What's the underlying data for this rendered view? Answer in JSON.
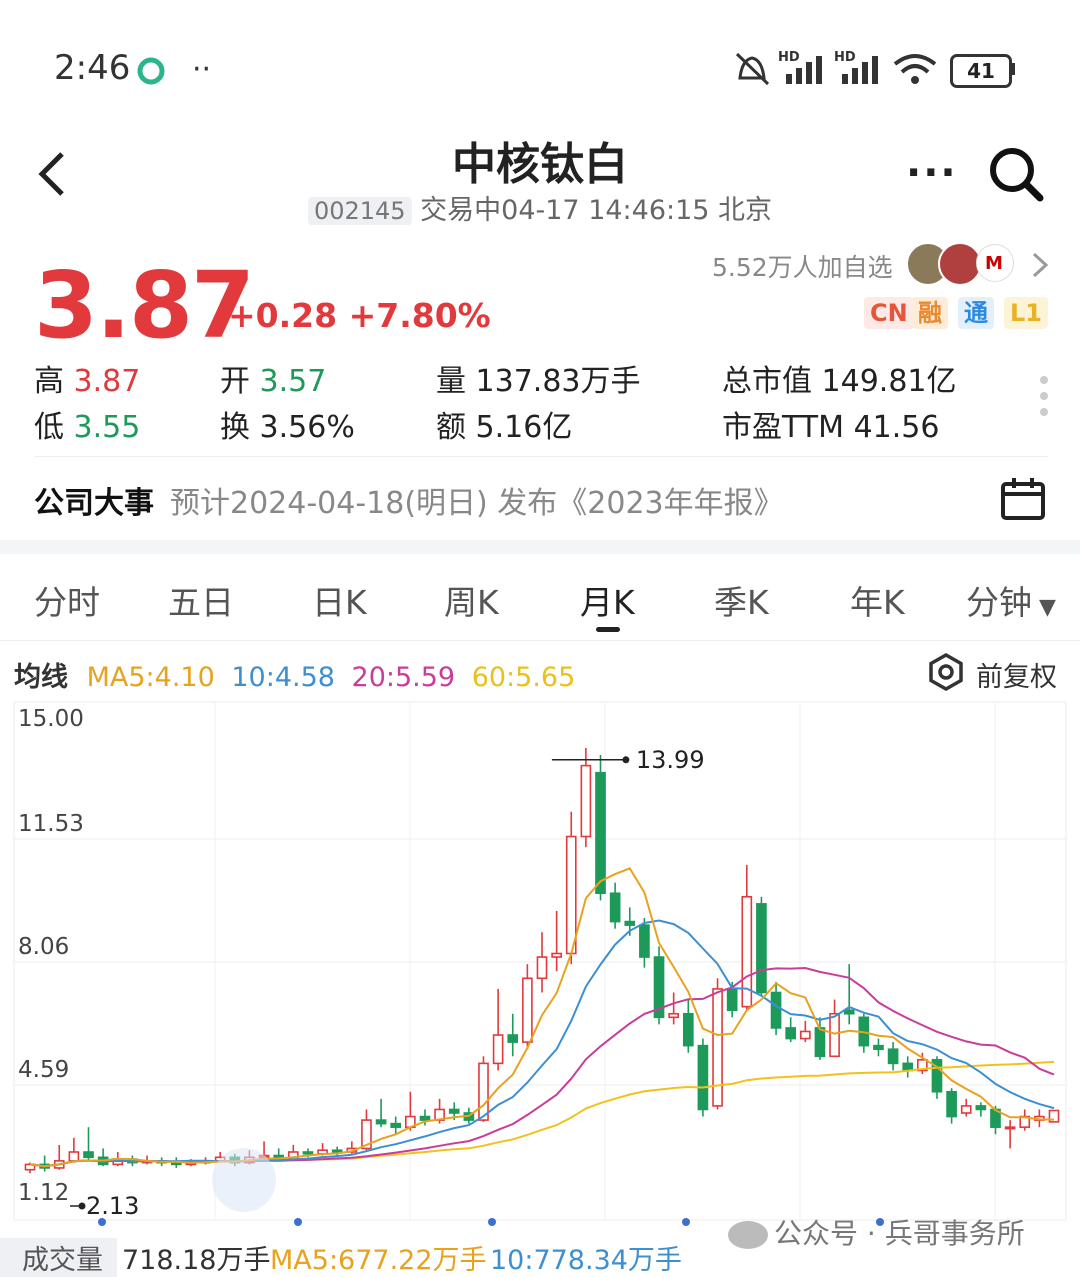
{
  "status": {
    "time": "2:46",
    "battery": "41",
    "signal1": "HD",
    "signal2": "HD"
  },
  "header": {
    "title": "中核钛白",
    "code": "002145",
    "status_text": "交易中04-17 14:46:15 北京"
  },
  "quote": {
    "price": "3.87",
    "change": "+0.28",
    "change_pct": "+7.80%",
    "watchers": "5.52万人加自选",
    "tags": [
      "CN",
      "融",
      "通",
      "L1"
    ]
  },
  "stats": {
    "high_label": "高",
    "high": "3.87",
    "open_label": "开",
    "open": "3.57",
    "volume_label": "量",
    "volume": "137.83万手",
    "mcap_label": "总市值",
    "mcap": "149.81亿",
    "low_label": "低",
    "low": "3.55",
    "turnover_label": "换",
    "turnover": "3.56%",
    "amount_label": "额",
    "amount": "5.16亿",
    "pe_label": "市盈TTM",
    "pe": "41.56"
  },
  "event": {
    "label": "公司大事",
    "text": "预计2024-04-18(明日) 发布《2023年年报》"
  },
  "tabs": [
    "分时",
    "五日",
    "日K",
    "周K",
    "月K",
    "季K",
    "年K",
    "分钟"
  ],
  "active_tab": "月K",
  "ma": {
    "label": "均线",
    "ma5": "MA5:4.10",
    "ma10": "10:4.58",
    "ma20": "20:5.59",
    "ma60": "60:5.65",
    "adjust": "前复权",
    "colors": {
      "ma5": "#e8a21d",
      "ma10": "#3d8fd1",
      "ma20": "#c83d9b",
      "ma60": "#f2c21b"
    }
  },
  "volume": {
    "label": "成交量",
    "value": "718.18万手",
    "ma5": "MA5:677.22万手",
    "ma10": "10:778.34万手"
  },
  "watermark": "公众号 · 兵哥事务所",
  "chart_data": {
    "type": "candlestick",
    "y_ticks": [
      "15.00",
      "11.53",
      "8.06",
      "4.59",
      "1.12"
    ],
    "ylim": [
      1.12,
      15.0
    ],
    "annotations": {
      "high": "13.99",
      "low": "2.13"
    },
    "candles": [
      [
        2.2,
        2.35,
        2.4,
        2.1
      ],
      [
        2.35,
        2.25,
        2.6,
        2.15
      ],
      [
        2.25,
        2.45,
        2.9,
        2.2
      ],
      [
        2.45,
        2.7,
        3.1,
        2.4
      ],
      [
        2.7,
        2.55,
        3.4,
        2.45
      ],
      [
        2.55,
        2.35,
        2.8,
        2.3
      ],
      [
        2.35,
        2.5,
        2.7,
        2.3
      ],
      [
        2.5,
        2.4,
        2.6,
        2.3
      ],
      [
        2.4,
        2.45,
        2.6,
        2.35
      ],
      [
        2.45,
        2.4,
        2.55,
        2.3
      ],
      [
        2.4,
        2.35,
        2.55,
        2.25
      ],
      [
        2.35,
        2.4,
        2.5,
        2.3
      ],
      [
        2.4,
        2.45,
        2.55,
        2.35
      ],
      [
        2.45,
        2.55,
        2.7,
        2.4
      ],
      [
        2.55,
        2.4,
        2.65,
        2.3
      ],
      [
        2.4,
        2.55,
        2.75,
        2.35
      ],
      [
        2.55,
        2.6,
        3.0,
        2.5
      ],
      [
        2.6,
        2.5,
        2.8,
        2.45
      ],
      [
        2.5,
        2.7,
        2.9,
        2.45
      ],
      [
        2.7,
        2.65,
        2.8,
        2.55
      ],
      [
        2.65,
        2.75,
        2.95,
        2.6
      ],
      [
        2.75,
        2.7,
        2.85,
        2.6
      ],
      [
        2.7,
        2.8,
        3.0,
        2.65
      ],
      [
        2.8,
        3.6,
        3.9,
        2.75
      ],
      [
        3.6,
        3.5,
        4.2,
        3.4
      ],
      [
        3.5,
        3.4,
        3.7,
        3.2
      ],
      [
        3.4,
        3.7,
        4.4,
        3.3
      ],
      [
        3.7,
        3.6,
        3.9,
        3.45
      ],
      [
        3.6,
        3.9,
        4.2,
        3.5
      ],
      [
        3.9,
        3.8,
        4.1,
        3.6
      ],
      [
        3.8,
        3.6,
        3.95,
        3.5
      ],
      [
        3.6,
        5.2,
        5.4,
        3.55
      ],
      [
        5.2,
        6.0,
        7.3,
        5.0
      ],
      [
        6.0,
        5.8,
        6.6,
        5.4
      ],
      [
        5.8,
        7.6,
        8.0,
        5.6
      ],
      [
        7.6,
        8.2,
        8.9,
        7.2
      ],
      [
        8.2,
        8.3,
        9.5,
        7.8
      ],
      [
        8.3,
        11.6,
        12.3,
        8.0
      ],
      [
        11.6,
        13.6,
        14.1,
        11.3
      ],
      [
        13.4,
        10.0,
        13.9,
        9.8
      ],
      [
        10.0,
        9.2,
        10.3,
        9.0
      ],
      [
        9.2,
        9.1,
        9.6,
        8.8
      ],
      [
        9.1,
        8.2,
        9.3,
        7.9
      ],
      [
        8.2,
        6.5,
        8.5,
        6.3
      ],
      [
        6.5,
        6.6,
        7.2,
        6.3
      ],
      [
        6.6,
        5.7,
        7.0,
        5.5
      ],
      [
        5.7,
        3.9,
        5.9,
        3.7
      ],
      [
        4.0,
        7.3,
        7.6,
        3.9
      ],
      [
        7.3,
        6.7,
        7.5,
        6.5
      ],
      [
        6.8,
        9.9,
        10.8,
        6.7
      ],
      [
        9.7,
        7.2,
        9.9,
        7.1
      ],
      [
        7.2,
        6.2,
        7.5,
        6.0
      ],
      [
        6.2,
        5.9,
        6.5,
        5.8
      ],
      [
        5.9,
        6.1,
        6.4,
        5.8
      ],
      [
        6.2,
        5.4,
        6.5,
        5.3
      ],
      [
        5.4,
        6.6,
        7.0,
        5.4
      ],
      [
        6.7,
        6.6,
        8.0,
        6.3
      ],
      [
        6.5,
        5.7,
        6.6,
        5.5
      ],
      [
        5.7,
        5.6,
        5.9,
        5.4
      ],
      [
        5.6,
        5.2,
        5.8,
        5.0
      ],
      [
        5.2,
        5.0,
        5.4,
        4.8
      ],
      [
        5.0,
        5.3,
        5.5,
        4.9
      ],
      [
        5.3,
        4.4,
        5.4,
        4.2
      ],
      [
        4.4,
        3.7,
        4.5,
        3.5
      ],
      [
        3.8,
        4.0,
        4.2,
        3.7
      ],
      [
        4.0,
        3.9,
        4.1,
        3.7
      ],
      [
        3.9,
        3.4,
        4.0,
        3.2
      ],
      [
        3.4,
        3.4,
        3.6,
        2.8
      ],
      [
        3.4,
        3.7,
        3.9,
        3.3
      ],
      [
        3.6,
        3.7,
        3.9,
        3.4
      ],
      [
        3.55,
        3.87,
        3.87,
        3.55
      ]
    ]
  }
}
